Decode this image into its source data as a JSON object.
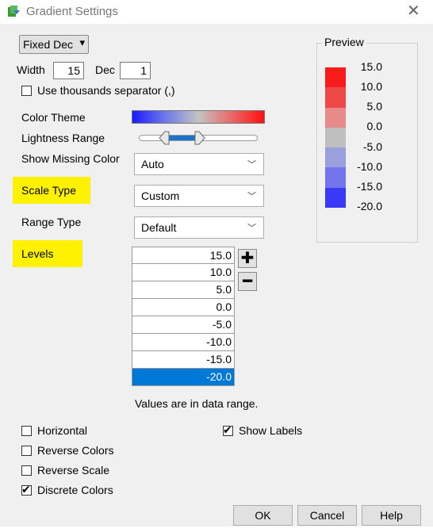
{
  "window": {
    "title": "Gradient Settings"
  },
  "format": {
    "mode": "Fixed Dec",
    "width_label": "Width",
    "width_value": "15",
    "dec_label": "Dec",
    "dec_value": "1"
  },
  "thousands": {
    "label": "Use thousands separator (,)",
    "checked": false
  },
  "color_theme": {
    "label": "Color Theme"
  },
  "lightness": {
    "label": "Lightness Range"
  },
  "missing": {
    "label": "Show Missing Color",
    "value": "Auto"
  },
  "scale_type": {
    "label": "Scale Type",
    "value": "Custom"
  },
  "range_type": {
    "label": "Range Type",
    "value": "Default"
  },
  "levels": {
    "label": "Levels",
    "values": [
      "15.0",
      "10.0",
      "5.0",
      "0.0",
      "-5.0",
      "-10.0",
      "-15.0",
      "-20.0"
    ],
    "selected_index": 7,
    "note": "Values are in data range."
  },
  "preview": {
    "label": "Preview",
    "labels": [
      "15.0",
      "10.0",
      "5.0",
      "0.0",
      "-5.0",
      "-10.0",
      "-15.0",
      "-20.0"
    ],
    "colors": [
      "#f81b1b",
      "#ee4848",
      "#e68a8a",
      "#d0a9a9",
      "#bfbfbf",
      "#9aa0dc",
      "#7474ec",
      "#3a3af6",
      "#1f2bff"
    ]
  },
  "options": {
    "horizontal": {
      "label": "Horizontal",
      "checked": false
    },
    "reverse_colors": {
      "label": "Reverse Colors",
      "checked": false
    },
    "reverse_scale": {
      "label": "Reverse Scale",
      "checked": false
    },
    "discrete_colors": {
      "label": "Discrete Colors",
      "checked": true
    },
    "show_labels": {
      "label": "Show Labels",
      "checked": true
    }
  },
  "buttons": {
    "ok": "OK",
    "cancel": "Cancel",
    "help": "Help"
  },
  "colors": {
    "highlight": "#fff200",
    "selection": "#0078d7",
    "slider_fill": "#1e73c8"
  }
}
